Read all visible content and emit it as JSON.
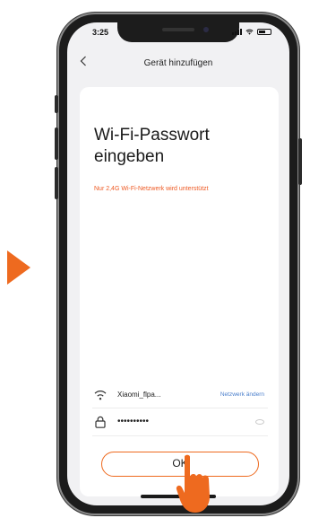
{
  "status": {
    "time": "3:25"
  },
  "nav": {
    "back_icon": "chevron-left-icon",
    "title": "Gerät hinzufügen"
  },
  "main": {
    "heading": "Wi-Fi-Passwort eingeben",
    "notice": "Nur 2,4G Wi-Fi-Netzwerk wird unterstützt"
  },
  "network": {
    "ssid": "Xiaomi_flpa...",
    "change_label": "Netzwerk ändern",
    "icon": "wifi-icon"
  },
  "password": {
    "masked": "••••••••••",
    "icon": "lock-icon"
  },
  "ok_button": {
    "label": "OK"
  },
  "colors": {
    "accent": "#ee6a1f",
    "notice": "#ee5a24",
    "link": "#4b7fcc"
  }
}
